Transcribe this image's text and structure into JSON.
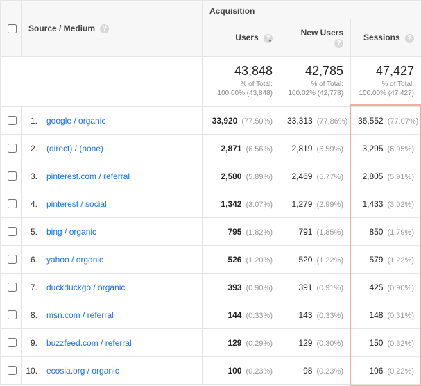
{
  "header": {
    "source_medium": "Source / Medium",
    "acquisition": "Acquisition",
    "users": "Users",
    "new_users": "New Users",
    "sessions": "Sessions"
  },
  "totals": {
    "users": {
      "value": "43,848",
      "label1": "% of Total:",
      "label2": "100.00% (43,848)"
    },
    "new_users": {
      "value": "42,785",
      "label1": "% of Total:",
      "label2": "100.02% (42,778)"
    },
    "sessions": {
      "value": "47,427",
      "label1": "% of Total:",
      "label2": "100.00% (47,427)"
    }
  },
  "rows": [
    {
      "idx": "1.",
      "source": "google / organic",
      "users": "33,920",
      "users_pct": "(77.50%)",
      "new": "33,313",
      "new_pct": "(77.86%)",
      "sess": "36,552",
      "sess_pct": "(77.07%)"
    },
    {
      "idx": "2.",
      "source": "(direct) / (none)",
      "users": "2,871",
      "users_pct": "(6.56%)",
      "new": "2,819",
      "new_pct": "(6.59%)",
      "sess": "3,295",
      "sess_pct": "(6.95%)"
    },
    {
      "idx": "3.",
      "source": "pinterest.com / referral",
      "users": "2,580",
      "users_pct": "(5.89%)",
      "new": "2,469",
      "new_pct": "(5.77%)",
      "sess": "2,805",
      "sess_pct": "(5.91%)"
    },
    {
      "idx": "4.",
      "source": "pinterest / social",
      "users": "1,342",
      "users_pct": "(3.07%)",
      "new": "1,279",
      "new_pct": "(2.99%)",
      "sess": "1,433",
      "sess_pct": "(3.02%)"
    },
    {
      "idx": "5.",
      "source": "bing / organic",
      "users": "795",
      "users_pct": "(1.82%)",
      "new": "791",
      "new_pct": "(1.85%)",
      "sess": "850",
      "sess_pct": "(1.79%)"
    },
    {
      "idx": "6.",
      "source": "yahoo / organic",
      "users": "526",
      "users_pct": "(1.20%)",
      "new": "520",
      "new_pct": "(1.22%)",
      "sess": "579",
      "sess_pct": "(1.22%)"
    },
    {
      "idx": "7.",
      "source": "duckduckgo / organic",
      "users": "393",
      "users_pct": "(0.90%)",
      "new": "391",
      "new_pct": "(0.91%)",
      "sess": "425",
      "sess_pct": "(0.90%)"
    },
    {
      "idx": "8.",
      "source": "msn.com / referral",
      "users": "144",
      "users_pct": "(0.33%)",
      "new": "143",
      "new_pct": "(0.33%)",
      "sess": "148",
      "sess_pct": "(0.31%)"
    },
    {
      "idx": "9.",
      "source": "buzzfeed.com / referral",
      "users": "129",
      "users_pct": "(0.29%)",
      "new": "129",
      "new_pct": "(0.30%)",
      "sess": "150",
      "sess_pct": "(0.32%)"
    },
    {
      "idx": "10.",
      "source": "ecosia.org / organic",
      "users": "100",
      "users_pct": "(0.23%)",
      "new": "98",
      "new_pct": "(0.23%)",
      "sess": "106",
      "sess_pct": "(0.22%)"
    }
  ]
}
